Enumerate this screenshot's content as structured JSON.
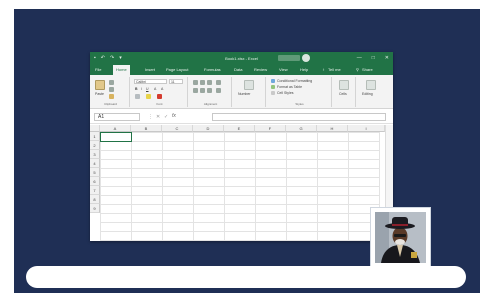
{
  "excel": {
    "title": "Book1.xlsx - Excel",
    "window_buttons": [
      "—",
      "□",
      "✕"
    ],
    "menu_tabs": [
      "File",
      "Home",
      "Insert",
      "Page Layout",
      "Formulas",
      "Data",
      "Review",
      "View",
      "Help"
    ],
    "active_tab": "Home",
    "tell_me": "Tell me",
    "share": "Share",
    "ribbon": {
      "paste": "Paste",
      "font_name": "Calibri",
      "font_size": "11",
      "number": "Number",
      "conditional_formatting": "Conditional Formatting",
      "format_as_table": "Format as Table",
      "cell_styles": "Cell Styles",
      "cells": "Cells",
      "editing": "Editing",
      "group_labels": [
        "Clipboard",
        "Font",
        "Alignment",
        "Styles"
      ]
    },
    "name_box": "A1",
    "fx": "fx",
    "columns": [
      "A",
      "B",
      "C",
      "D",
      "E",
      "F",
      "G",
      "H",
      "I"
    ],
    "rows": [
      "1",
      "2",
      "3",
      "4",
      "5",
      "6",
      "7",
      "8",
      "9"
    ]
  },
  "colors": {
    "background": "#1f2f55",
    "excel_green": "#217346"
  }
}
